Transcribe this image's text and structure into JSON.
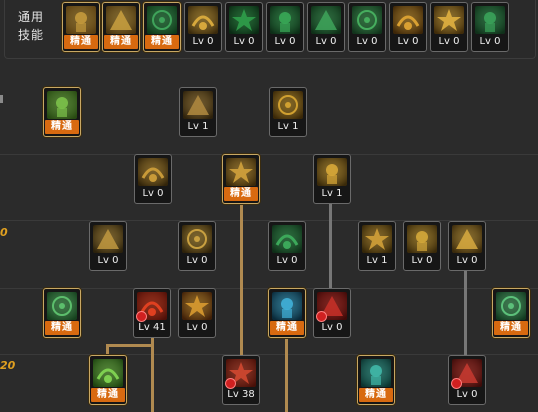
{
  "header": {
    "label_line1": "通用",
    "label_line2": "技能"
  },
  "level_markers": [
    "0",
    "20"
  ],
  "common_skills": [
    {
      "name": "common-skill-1",
      "label": "精通",
      "mastery": true,
      "icon": "reading-figure-icon",
      "colors": [
        "#c49a3c",
        "#5a3f12"
      ]
    },
    {
      "name": "common-skill-2",
      "label": "精通",
      "mastery": true,
      "icon": "swirl-figure-icon",
      "colors": [
        "#c9a040",
        "#4a3510"
      ]
    },
    {
      "name": "common-skill-3",
      "label": "精通",
      "mastery": true,
      "icon": "running-figure-icon",
      "colors": [
        "#3fa35a",
        "#0f3a1a"
      ]
    },
    {
      "name": "common-skill-4",
      "label": "Lv 0",
      "mastery": false,
      "icon": "golden-wings-icon",
      "colors": [
        "#d6a83c",
        "#3a2a0c"
      ]
    },
    {
      "name": "common-skill-5",
      "label": "Lv 0",
      "mastery": false,
      "icon": "green-crosshair-icon",
      "colors": [
        "#2f9d4a",
        "#0b2a14"
      ]
    },
    {
      "name": "common-skill-6",
      "label": "Lv 0",
      "mastery": false,
      "icon": "green-target-icon",
      "colors": [
        "#39a857",
        "#0d2e17"
      ]
    },
    {
      "name": "common-skill-7",
      "label": "Lv 0",
      "mastery": false,
      "icon": "green-figure-icon",
      "colors": [
        "#3ea45a",
        "#0f3018"
      ]
    },
    {
      "name": "common-skill-8",
      "label": "Lv 0",
      "mastery": false,
      "icon": "green-punch-icon",
      "colors": [
        "#46ad5e",
        "#12341c"
      ]
    },
    {
      "name": "common-skill-9",
      "label": "Lv 0",
      "mastery": false,
      "icon": "golden-eye-icon",
      "colors": [
        "#d9a032",
        "#3d2608"
      ]
    },
    {
      "name": "common-skill-10",
      "label": "Lv 0",
      "mastery": false,
      "icon": "golden-aura-icon",
      "colors": [
        "#e0b040",
        "#402c0a"
      ]
    },
    {
      "name": "common-skill-11",
      "label": "Lv 0",
      "mastery": false,
      "icon": "green-leap-icon",
      "colors": [
        "#3aa35a",
        "#10301a"
      ]
    }
  ],
  "tree_skills": [
    {
      "name": "tree-skill-r1-a",
      "label": "精通",
      "mastery": true,
      "icon": "green-book-icon",
      "colors": [
        "#7cc24a",
        "#284a12"
      ]
    },
    {
      "name": "tree-skill-r1-b",
      "label": "Lv 1",
      "mastery": false,
      "icon": "golden-stance-icon",
      "colors": [
        "#b08a40",
        "#2e220c"
      ]
    },
    {
      "name": "tree-skill-r1-c",
      "label": "Lv 1",
      "mastery": false,
      "icon": "golden-slash-icon",
      "colors": [
        "#d0a030",
        "#3a2808"
      ]
    },
    {
      "name": "tree-skill-r2-a",
      "label": "Lv 0",
      "mastery": false,
      "icon": "golden-kick-icon",
      "colors": [
        "#c89a38",
        "#32240a"
      ]
    },
    {
      "name": "tree-skill-r2-b",
      "label": "精通",
      "mastery": true,
      "icon": "golden-guard-icon",
      "colors": [
        "#d2a23c",
        "#3a290a"
      ]
    },
    {
      "name": "tree-skill-r2-c",
      "label": "Lv 1",
      "mastery": false,
      "icon": "golden-burst-icon",
      "colors": [
        "#d8a838",
        "#3a2a0a"
      ]
    },
    {
      "name": "tree-skill-r3-a",
      "label": "Lv 0",
      "mastery": false,
      "icon": "golden-spark-icon",
      "colors": [
        "#c09840",
        "#2c220c"
      ]
    },
    {
      "name": "tree-skill-r3-b",
      "label": "Lv 0",
      "mastery": false,
      "icon": "golden-crescent-icon",
      "colors": [
        "#c8a040",
        "#2e220a"
      ]
    },
    {
      "name": "tree-skill-r3-c",
      "label": "Lv 0",
      "mastery": false,
      "icon": "green-armor-icon",
      "colors": [
        "#3ca85a",
        "#0f2e18"
      ]
    },
    {
      "name": "tree-skill-r3-d",
      "label": "Lv 1",
      "mastery": false,
      "icon": "golden-flurry-icon",
      "colors": [
        "#d0a038",
        "#342608"
      ]
    },
    {
      "name": "tree-skill-r3-e",
      "label": "Lv 0",
      "mastery": false,
      "icon": "golden-push-icon",
      "colors": [
        "#d4a83a",
        "#3a2a0a"
      ]
    },
    {
      "name": "tree-skill-r3-f",
      "label": "Lv 0",
      "mastery": false,
      "icon": "golden-strike-icon",
      "colors": [
        "#d8aa40",
        "#3a2a0c"
      ]
    },
    {
      "name": "tree-skill-r4-a",
      "label": "精通",
      "mastery": true,
      "icon": "green-body-icon",
      "colors": [
        "#5cbe6c",
        "#16401e"
      ]
    },
    {
      "name": "tree-skill-r4-b",
      "label": "Lv 41",
      "mastery": false,
      "icon": "red-fireball-icon",
      "colors": [
        "#e04020",
        "#501008"
      ]
    },
    {
      "name": "tree-skill-r4-c",
      "label": "Lv 0",
      "mastery": false,
      "icon": "golden-vortex-icon",
      "colors": [
        "#d89a30",
        "#402008"
      ]
    },
    {
      "name": "tree-skill-r4-d",
      "label": "精通",
      "mastery": true,
      "icon": "blue-star-icon",
      "colors": [
        "#40b0d8",
        "#0a2a3a"
      ]
    },
    {
      "name": "tree-skill-r4-e",
      "label": "Lv 0",
      "mastery": false,
      "icon": "red-figure-icon",
      "colors": [
        "#c83028",
        "#400a08"
      ]
    },
    {
      "name": "tree-skill-r4-f",
      "label": "精通",
      "mastery": true,
      "icon": "green-star-icon",
      "colors": [
        "#5cc07a",
        "#123a20"
      ]
    },
    {
      "name": "tree-skill-r5-a",
      "label": "精通",
      "mastery": true,
      "icon": "green-arrow-icon",
      "colors": [
        "#7ed050",
        "#1e4410"
      ]
    },
    {
      "name": "tree-skill-r5-b",
      "label": "Lv 38",
      "mastery": false,
      "icon": "red-totem-icon",
      "colors": [
        "#d04830",
        "#481008"
      ]
    },
    {
      "name": "tree-skill-r5-c",
      "label": "精通",
      "mastery": true,
      "icon": "teal-shield-icon",
      "colors": [
        "#40b8a8",
        "#0c3430"
      ]
    },
    {
      "name": "tree-skill-r5-d",
      "label": "Lv 0",
      "mastery": false,
      "icon": "red-leap-icon",
      "colors": [
        "#c83a30",
        "#3e0c0a"
      ]
    }
  ]
}
